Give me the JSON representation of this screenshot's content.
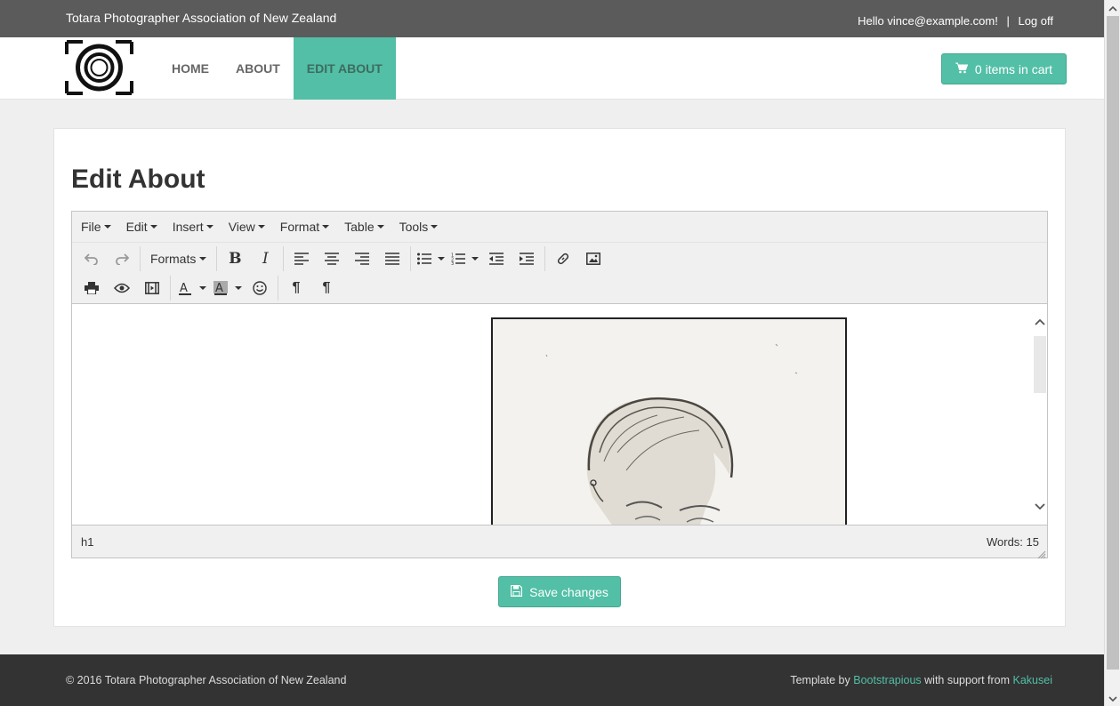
{
  "topbar": {
    "site_name": "Totara Photographer Association of New Zealand",
    "greeting": "Hello vince@example.com!",
    "separator": "|",
    "logoff": "Log off"
  },
  "nav": {
    "items": [
      {
        "label": "HOME"
      },
      {
        "label": "ABOUT"
      },
      {
        "label": "EDIT ABOUT"
      }
    ],
    "active_index": 2,
    "cart_label": "0 items in cart"
  },
  "page": {
    "title": "Edit About"
  },
  "editor": {
    "menu": [
      "File",
      "Edit",
      "Insert",
      "View",
      "Format",
      "Table",
      "Tools"
    ],
    "toolbar": {
      "formats_label": "Formats",
      "row1_icons": [
        "undo-icon",
        "redo-icon",
        "bold-icon",
        "italic-icon",
        "align-left-icon",
        "align-center-icon",
        "align-right-icon",
        "align-justify-icon",
        "bullet-list-icon",
        "numbered-list-icon",
        "outdent-icon",
        "indent-icon",
        "link-icon",
        "image-icon"
      ],
      "row2_icons": [
        "print-icon",
        "preview-icon",
        "media-icon",
        "text-color-icon",
        "background-color-icon",
        "emoticons-icon",
        "ltr-icon",
        "rtl-icon"
      ]
    },
    "status_path": "h1",
    "word_count": "Words: 15"
  },
  "save_button": "Save changes",
  "footer": {
    "copyright": "© 2016 Totara Photographer Association of New Zealand",
    "credit_prefix": "Template by",
    "credit_link1": "Bootstrapious",
    "credit_middle": "with support from",
    "credit_link2": "Kakusei"
  },
  "colors": {
    "accent": "#52bfa6",
    "topbar": "#5b5b5b",
    "footer": "#333333"
  }
}
